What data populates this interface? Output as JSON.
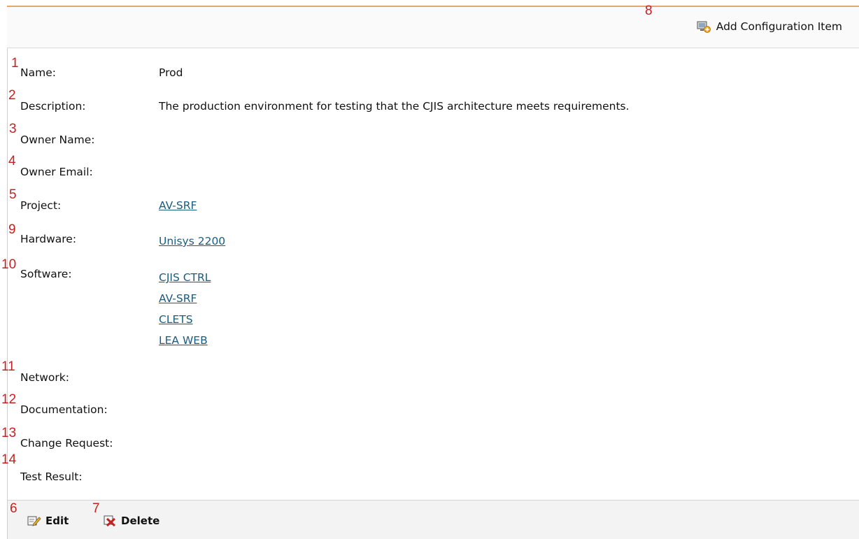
{
  "toolbar": {
    "add_label": "Add Configuration Item",
    "add_icon": "add-item-icon"
  },
  "markers": [
    "1",
    "2",
    "3",
    "4",
    "5",
    "9",
    "10",
    "11",
    "12",
    "13",
    "14",
    "6",
    "7",
    "8"
  ],
  "fields": {
    "name": {
      "label": "Name:",
      "value": "Prod"
    },
    "description": {
      "label": "Description:",
      "value": "The production environment for testing that the CJIS architecture meets requirements."
    },
    "owner_name": {
      "label": "Owner Name:",
      "value": ""
    },
    "owner_email": {
      "label": "Owner Email:",
      "value": ""
    },
    "project": {
      "label": "Project:",
      "value": "AV-SRF"
    },
    "hardware": {
      "label": "Hardware:",
      "value": "Unisys 2200"
    },
    "software": {
      "label": "Software:",
      "items": [
        "CJIS CTRL",
        "AV-SRF",
        "CLETS",
        "LEA WEB"
      ]
    },
    "network": {
      "label": "Network:"
    },
    "documentation": {
      "label": "Documentation:"
    },
    "change_request": {
      "label": "Change Request:"
    },
    "test_result": {
      "label": "Test Result:"
    }
  },
  "footer": {
    "edit_label": "Edit",
    "delete_label": "Delete",
    "edit_icon": "edit-icon",
    "delete_icon": "delete-icon"
  },
  "colors": {
    "link": "#1b5c7e",
    "marker": "#c32222",
    "accent_line": "#e0a96a"
  }
}
